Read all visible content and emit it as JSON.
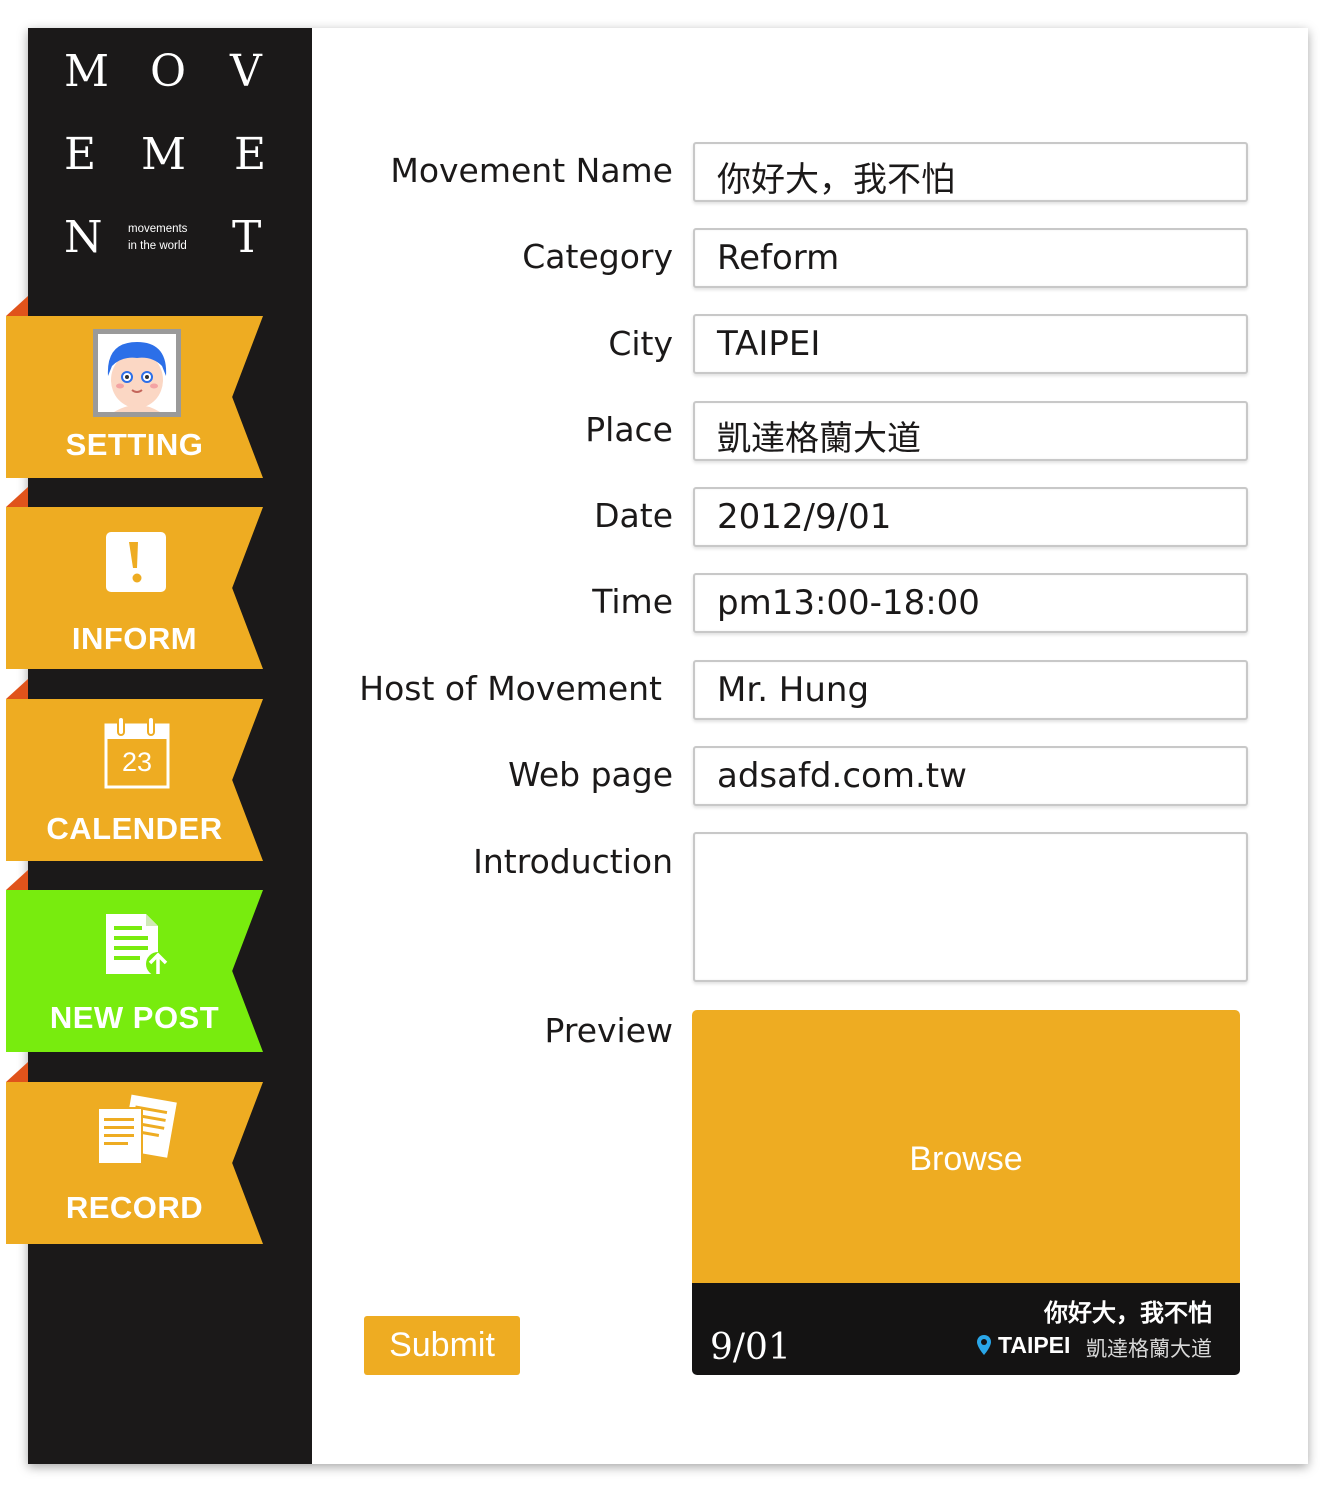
{
  "logo": {
    "letters": [
      "M",
      "O",
      "V",
      "E",
      "M",
      "E",
      "N",
      "T"
    ],
    "tagline_line1": "movements",
    "tagline_line2": "in the world"
  },
  "nav": [
    {
      "label": "SETTING",
      "icon": "avatar-icon",
      "active": false
    },
    {
      "label": "INFORM",
      "icon": "exclamation-icon",
      "active": false
    },
    {
      "label": "CALENDER",
      "icon": "calendar-icon",
      "calendar_day": "23",
      "active": false
    },
    {
      "label": "NEW POST",
      "icon": "document-upload-icon",
      "active": true
    },
    {
      "label": "RECORD",
      "icon": "documents-icon",
      "active": false
    }
  ],
  "form": {
    "movement_name_label": "Movement Name",
    "movement_name_value": "你好大，我不怕",
    "category_label": "Category",
    "category_value": "Reform",
    "city_label": "City",
    "city_value": "TAIPEI",
    "place_label": "Place",
    "place_value": "凱達格蘭大道",
    "date_label": "Date",
    "date_value": "2012/9/01",
    "time_label": "Time",
    "time_value": "pm13:00-18:00",
    "host_label": "Host of Movement",
    "host_value": "Mr. Hung",
    "web_label": "Web page",
    "web_value": "adsafd.com.tw",
    "intro_label": "Introduction",
    "intro_value": "",
    "preview_label": "Preview"
  },
  "preview": {
    "browse_label": "Browse",
    "date": "9/01",
    "title": "你好大，我不怕",
    "city": "TAIPEI",
    "place": "凱達格蘭大道"
  },
  "submit_label": "Submit",
  "colors": {
    "orange": "#eeac22",
    "green": "#78ec0e",
    "dark": "#1b1919",
    "fold": "#e0531b"
  }
}
